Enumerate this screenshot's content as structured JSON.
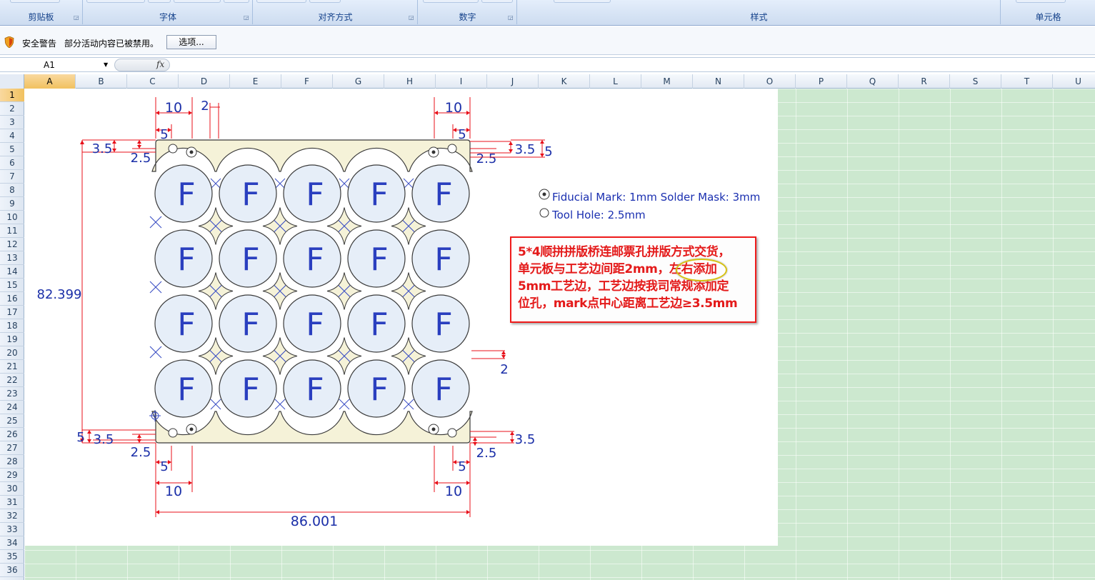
{
  "ribbon": {
    "groups": [
      {
        "label": "剪贴板"
      },
      {
        "label": "字体"
      },
      {
        "label": "对齐方式"
      },
      {
        "label": "数字"
      },
      {
        "label": "样式"
      },
      {
        "label": "单元格"
      }
    ],
    "launcher_icon": "dialog-launcher-icon"
  },
  "security": {
    "icon": "shield-warning-icon",
    "title": "安全警告",
    "message": "部分活动内容已被禁用。",
    "options_button": "选项..."
  },
  "formula_bar": {
    "name_box": "A1",
    "fx_label": "fx",
    "formula": ""
  },
  "sheet": {
    "columns": [
      "A",
      "B",
      "C",
      "D",
      "E",
      "F",
      "G",
      "H",
      "I",
      "J",
      "K",
      "L",
      "M",
      "N",
      "O",
      "P",
      "Q",
      "R",
      "S",
      "T",
      "U"
    ],
    "rows": [
      "1",
      "2",
      "3",
      "4",
      "5",
      "6",
      "7",
      "8",
      "9",
      "10",
      "11",
      "12",
      "13",
      "14",
      "15",
      "16",
      "17",
      "18",
      "19",
      "20",
      "21",
      "22",
      "23",
      "24",
      "25",
      "26",
      "27",
      "28",
      "29",
      "30",
      "31",
      "32",
      "33",
      "34",
      "35",
      "36"
    ],
    "selected_cell": "A1"
  },
  "drawing": {
    "cell_letter": "F",
    "dims": {
      "d10": "10",
      "d5": "5",
      "d2": "2",
      "d3_5": "3.5",
      "d2_5": "2.5",
      "height": "82.399",
      "width": "86.001"
    },
    "legend": {
      "fiducial": "Fiducial Mark: 1mm  Solder Mask: 3mm",
      "tool_hole": "Tool Hole: 2.5mm"
    },
    "colors": {
      "dimension": "#e8101a",
      "dimension_text": "#1b2fa8",
      "board_fill": "#f5f2d8",
      "circle_fill": "#e6eef8",
      "outline": "#3a3a3a"
    }
  },
  "note": {
    "lines": [
      "5*4顺拼拼版桥连邮票孔拼版方式交货，",
      "单元板与工艺边间距2mm，左右添加",
      "5mm工艺边，工艺边按我司常规添加定",
      "位孔，mark点中心距离工艺边≥3.5mm"
    ]
  }
}
